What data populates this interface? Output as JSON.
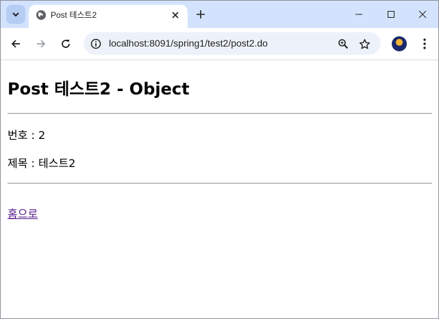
{
  "browser": {
    "tab": {
      "title": "Post 테스트2"
    },
    "address": {
      "url": "localhost:8091/spring1/test2/post2.do"
    }
  },
  "page": {
    "title": "Post 테스트2 - Object",
    "fields": [
      {
        "label": "번호",
        "separator": " : ",
        "value": "2"
      },
      {
        "label": "제목",
        "separator": " : ",
        "value": "테스트2"
      }
    ],
    "home_link": "홈으로"
  },
  "colors": {
    "tabstrip": "#d3e3fd",
    "omnibox": "#edf2fa",
    "visited_link": "#551a8b"
  },
  "icons": [
    "tab-search-icon",
    "globe-icon",
    "close-icon",
    "plus-icon",
    "minimize-icon",
    "maximize-icon",
    "window-close-icon",
    "back-arrow-icon",
    "forward-arrow-icon",
    "reload-icon",
    "site-info-icon",
    "zoom-icon",
    "star-icon",
    "more-icon"
  ]
}
